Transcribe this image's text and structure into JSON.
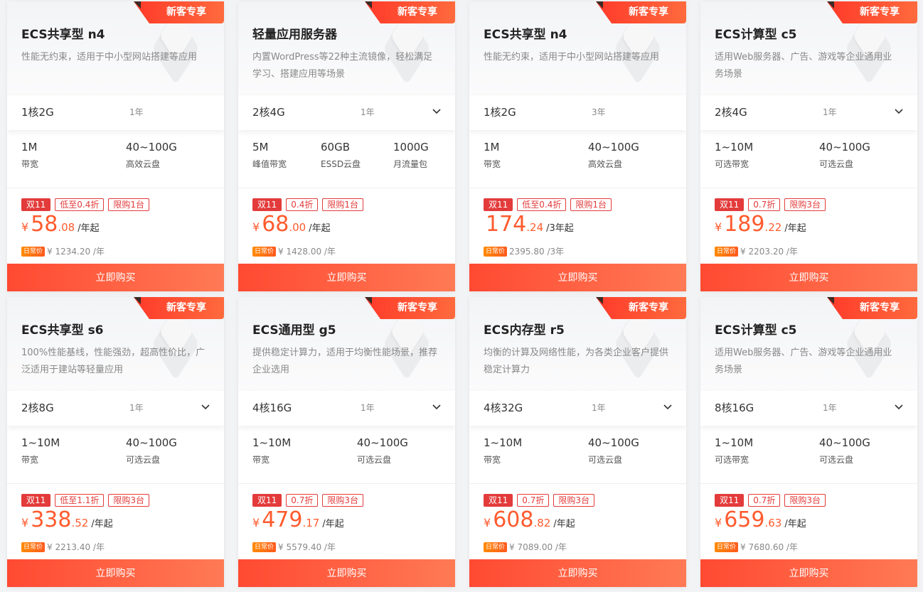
{
  "cards": [
    {
      "ribbon": "新客专享",
      "title": "ECS共享型 n4",
      "desc": "性能无约束，适用于中小型网站搭建等应用",
      "config": "1核2G",
      "duration": "1年",
      "has_dropdown": false,
      "params": [
        {
          "value": "1M",
          "label": "带宽"
        },
        {
          "value": "40~100G",
          "label": "高效云盘"
        }
      ],
      "tags": [
        {
          "text": "双11",
          "type": "promo"
        },
        {
          "text": "低至0.4折",
          "type": "outline"
        },
        {
          "text": "限购1台",
          "type": "outline"
        }
      ],
      "price": {
        "currency": "¥",
        "integer": "58",
        "decimal": ".08",
        "unit": "/年起"
      },
      "daily_badge": "日常价",
      "daily_price": "¥ 1234.20 /年",
      "buy_label": "立即购买"
    },
    {
      "ribbon": "新客专享",
      "title": "轻量应用服务器",
      "desc": "内置WordPress等22种主流镜像，轻松满足学习、搭建应用等场景",
      "config": "2核4G",
      "duration": "1年",
      "has_dropdown": true,
      "params": [
        {
          "value": "5M",
          "label": "峰值带宽"
        },
        {
          "value": "60GB",
          "label": "ESSD云盘"
        },
        {
          "value": "1000G",
          "label": "月流量包"
        }
      ],
      "tags": [
        {
          "text": "双11",
          "type": "promo"
        },
        {
          "text": "0.4折",
          "type": "outline"
        },
        {
          "text": "限购1台",
          "type": "outline"
        }
      ],
      "price": {
        "currency": "¥",
        "integer": "68",
        "decimal": ".00",
        "unit": "/年起"
      },
      "daily_badge": "日常价",
      "daily_price": "¥ 1428.00 /年",
      "buy_label": "立即购买"
    },
    {
      "ribbon": "新客专享",
      "title": "ECS共享型 n4",
      "desc": "性能无约束，适用于中小型网站搭建等应用",
      "config": "1核2G",
      "duration": "3年",
      "has_dropdown": false,
      "params": [
        {
          "value": "1M",
          "label": "带宽"
        },
        {
          "value": "40~100G",
          "label": "高效云盘"
        }
      ],
      "tags": [
        {
          "text": "双11",
          "type": "promo"
        },
        {
          "text": "低至0.4折",
          "type": "outline"
        },
        {
          "text": "限购1台",
          "type": "outline"
        }
      ],
      "price": {
        "currency": "",
        "integer": "174",
        "decimal": ".24",
        "unit": "/3年起"
      },
      "daily_badge": "日常价",
      "daily_price": "2395.80 /3年",
      "buy_label": "立即购买"
    },
    {
      "ribbon": "新客专享",
      "title": "ECS计算型 c5",
      "desc": "适用Web服务器、广告、游戏等企业通用业务场景",
      "config": "2核4G",
      "duration": "1年",
      "has_dropdown": true,
      "params": [
        {
          "value": "1~10M",
          "label": "可选带宽"
        },
        {
          "value": "40~100G",
          "label": "可选云盘"
        }
      ],
      "tags": [
        {
          "text": "双11",
          "type": "promo"
        },
        {
          "text": "0.7折",
          "type": "outline"
        },
        {
          "text": "限购3台",
          "type": "outline"
        }
      ],
      "price": {
        "currency": "¥",
        "integer": "189",
        "decimal": ".22",
        "unit": "/年起"
      },
      "daily_badge": "日常价",
      "daily_price": "¥ 2203.20 /年",
      "buy_label": "立即购买"
    },
    {
      "ribbon": "新客专享",
      "title": "ECS共享型 s6",
      "desc": "100%性能基线，性能强劲，超高性价比，广泛适用于建站等轻量应用",
      "config": "2核8G",
      "duration": "1年",
      "has_dropdown": true,
      "params": [
        {
          "value": "1~10M",
          "label": "带宽"
        },
        {
          "value": "40~100G",
          "label": "可选云盘"
        }
      ],
      "tags": [
        {
          "text": "双11",
          "type": "promo"
        },
        {
          "text": "低至1.1折",
          "type": "outline"
        },
        {
          "text": "限购3台",
          "type": "outline"
        }
      ],
      "price": {
        "currency": "¥",
        "integer": "338",
        "decimal": ".52",
        "unit": "/年起"
      },
      "daily_badge": "日常价",
      "daily_price": "¥ 2213.40 /年",
      "buy_label": "立即购买"
    },
    {
      "ribbon": "新客专享",
      "title": "ECS通用型 g5",
      "desc": "提供稳定计算力，适用于均衡性能场景，推荐企业选用",
      "config": "4核16G",
      "duration": "1年",
      "has_dropdown": true,
      "params": [
        {
          "value": "1~10M",
          "label": "带宽"
        },
        {
          "value": "40~100G",
          "label": "可选云盘"
        }
      ],
      "tags": [
        {
          "text": "双11",
          "type": "promo"
        },
        {
          "text": "0.7折",
          "type": "outline"
        },
        {
          "text": "限购3台",
          "type": "outline"
        }
      ],
      "price": {
        "currency": "¥",
        "integer": "479",
        "decimal": ".17",
        "unit": "/年起"
      },
      "daily_badge": "日常价",
      "daily_price": "¥ 5579.40 /年",
      "buy_label": "立即购买"
    },
    {
      "ribbon": "新客专享",
      "title": "ECS内存型 r5",
      "desc": "均衡的计算及网络性能，为各类企业客户提供稳定计算力",
      "config": "4核32G",
      "duration": "1年",
      "has_dropdown": true,
      "params": [
        {
          "value": "1~10M",
          "label": "带宽"
        },
        {
          "value": "40~100G",
          "label": "可选云盘"
        }
      ],
      "tags": [
        {
          "text": "双11",
          "type": "promo"
        },
        {
          "text": "0.7折",
          "type": "outline"
        },
        {
          "text": "限购3台",
          "type": "outline"
        }
      ],
      "price": {
        "currency": "¥",
        "integer": "608",
        "decimal": ".82",
        "unit": "/年起"
      },
      "daily_badge": "日常价",
      "daily_price": "¥ 7089.00 /年",
      "buy_label": "立即购买"
    },
    {
      "ribbon": "新客专享",
      "title": "ECS计算型 c5",
      "desc": "适用Web服务器、广告、游戏等企业通用业务场景",
      "config": "8核16G",
      "duration": "1年",
      "has_dropdown": true,
      "params": [
        {
          "value": "1~10M",
          "label": "可选带宽"
        },
        {
          "value": "40~100G",
          "label": "可选云盘"
        }
      ],
      "tags": [
        {
          "text": "双11",
          "type": "promo"
        },
        {
          "text": "0.7折",
          "type": "outline"
        },
        {
          "text": "限购3台",
          "type": "outline"
        }
      ],
      "price": {
        "currency": "¥",
        "integer": "659",
        "decimal": ".63",
        "unit": "/年起"
      },
      "daily_badge": "日常价",
      "daily_price": "¥ 7680.60 /年",
      "buy_label": "立即购买"
    }
  ]
}
